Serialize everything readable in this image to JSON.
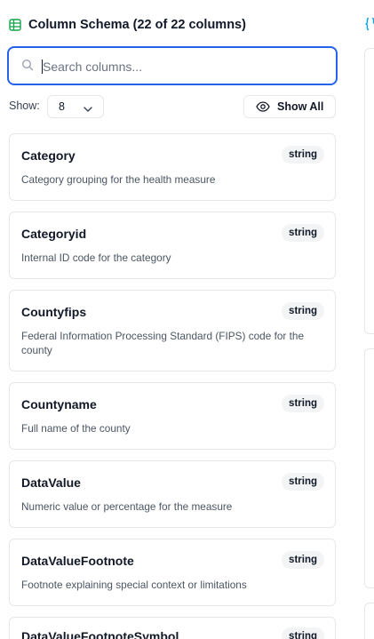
{
  "header": {
    "title": "Column Schema (22 of 22 columns)"
  },
  "search": {
    "placeholder": "Search columns...",
    "value": ""
  },
  "controls": {
    "show_label": "Show:",
    "show_value": "8",
    "show_all_label": "Show All"
  },
  "columns": [
    {
      "name": "Category",
      "type": "string",
      "description": "Category grouping for the health measure"
    },
    {
      "name": "Categoryid",
      "type": "string",
      "description": "Internal ID code for the category"
    },
    {
      "name": "Countyfips",
      "type": "string",
      "description": "Federal Information Processing Standard (FIPS) code for the county"
    },
    {
      "name": "Countyname",
      "type": "string",
      "description": "Full name of the county"
    },
    {
      "name": "DataValue",
      "type": "string",
      "description": "Numeric value or percentage for the measure"
    },
    {
      "name": "DataValueFootnote",
      "type": "string",
      "description": "Footnote explaining special context or limitations"
    },
    {
      "name": "DataValueFootnoteSymbol",
      "type": "string",
      "description": ""
    }
  ],
  "colors": {
    "accent": "#2563eb",
    "table_icon": "#16a34a",
    "right_icon": "#0ea5e9"
  }
}
